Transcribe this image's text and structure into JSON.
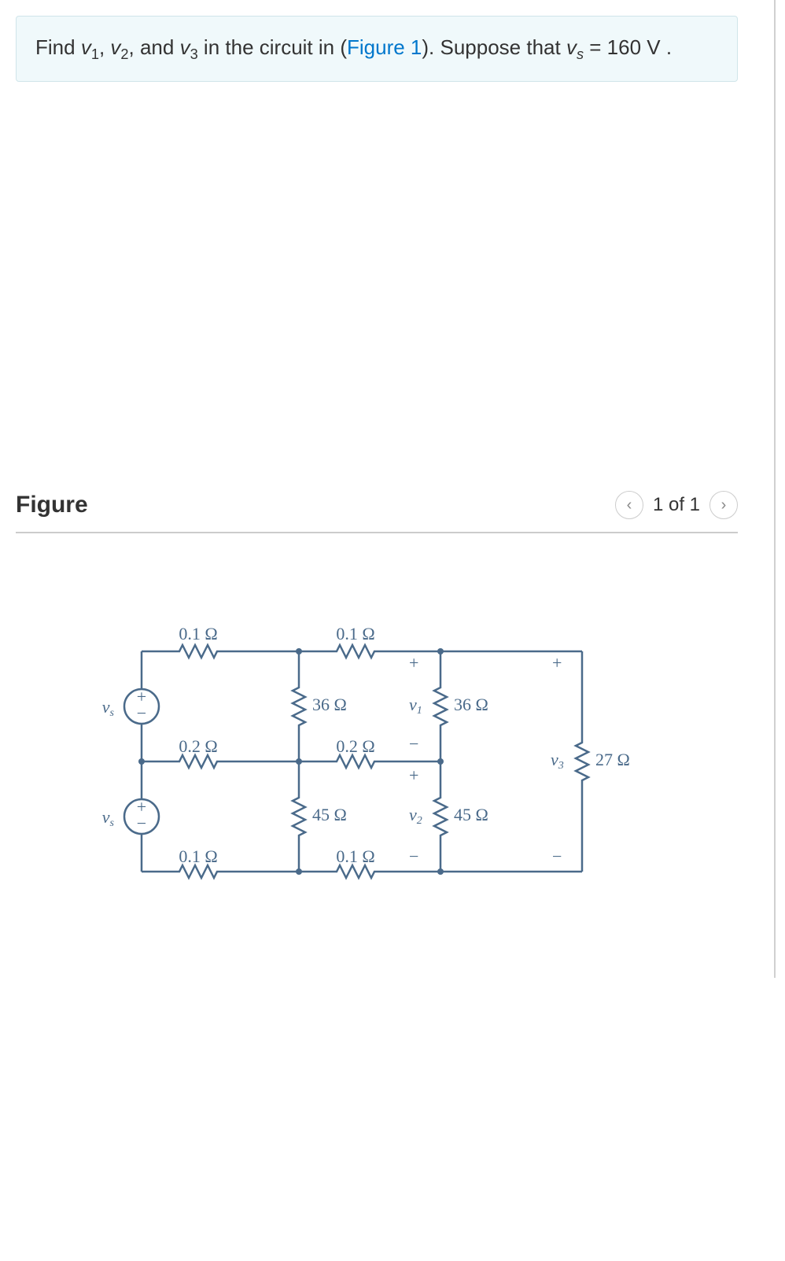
{
  "problem": {
    "text_parts": {
      "find": "Find ",
      "v1": "v",
      "sub1": "1",
      "comma1": ", ",
      "v2": "v",
      "sub2": "2",
      "comma2": ", and ",
      "v3": "v",
      "sub3": "3",
      "in_circuit": " in the circuit in (",
      "figure_link": "Figure 1",
      "close_paren": "). Suppose that ",
      "vs": "v",
      "subs": "s",
      "equals": " = 160  V ."
    }
  },
  "figure": {
    "title": "Figure",
    "nav_label": "1 of 1",
    "prev": "‹",
    "next": "›"
  },
  "circuit": {
    "labels": {
      "r_top1": "0.1 Ω",
      "r_top2": "0.1 Ω",
      "r_mid_left": "36 Ω",
      "r_mid_right": "36 Ω",
      "r_middle1": "0.2 Ω",
      "r_middle2": "0.2 Ω",
      "r_bot_left": "45 Ω",
      "r_bot_right": "45 Ω",
      "r_bottom1": "0.1 Ω",
      "r_bottom2": "0.1 Ω",
      "r_right": "27 Ω",
      "vs1": "v",
      "vs1_sub": "s",
      "vs2": "v",
      "vs2_sub": "s",
      "v1": "v",
      "v1_sub": "1",
      "v2": "v",
      "v2_sub": "2",
      "v3": "v",
      "v3_sub": "3",
      "plus": "+",
      "minus": "−"
    }
  }
}
